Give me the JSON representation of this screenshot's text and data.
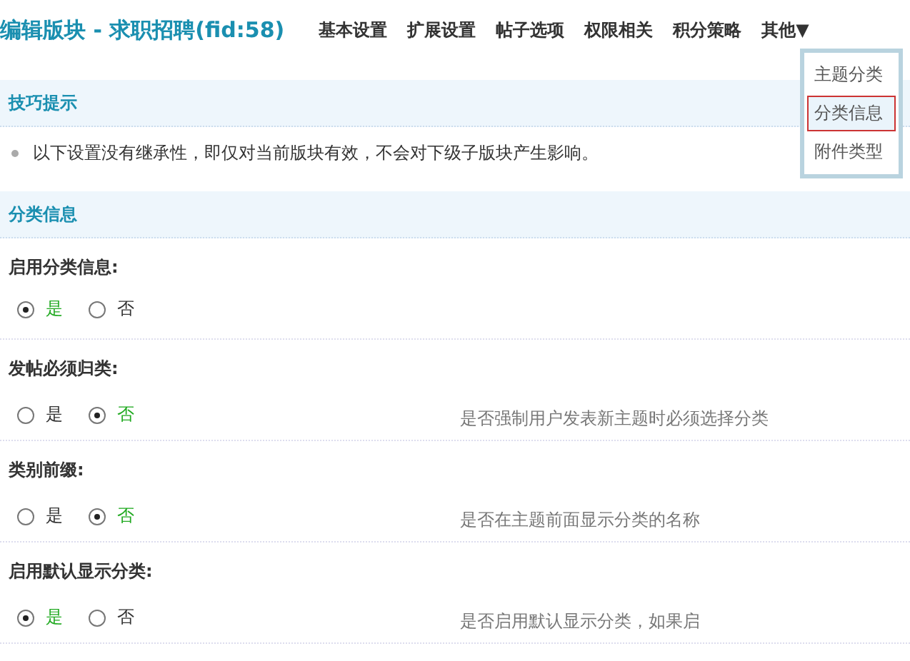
{
  "title": "编辑版块 - 求职招聘(fid:58)",
  "nav": [
    {
      "label": "基本设置",
      "selected": false
    },
    {
      "label": "扩展设置",
      "selected": false
    },
    {
      "label": "帖子选项",
      "selected": false
    },
    {
      "label": "权限相关",
      "selected": false
    },
    {
      "label": "积分策略",
      "selected": false
    },
    {
      "label": "其他",
      "selected": false,
      "caret": "▼"
    }
  ],
  "dropdown": [
    {
      "label": "主题分类",
      "selected": false
    },
    {
      "label": "分类信息",
      "selected": true
    },
    {
      "label": "附件类型",
      "selected": false
    }
  ],
  "tips": {
    "heading": "技巧提示",
    "items": [
      "以下设置没有继承性，即仅对当前版块有效，不会对下级子版块产生影响。"
    ]
  },
  "section": {
    "heading": "分类信息"
  },
  "settings": [
    {
      "label": "启用分类信息:",
      "options": [
        {
          "label": "是",
          "selected": true
        },
        {
          "label": "否",
          "selected": false
        }
      ]
    },
    {
      "label": "发帖必须归类:",
      "options": [
        {
          "label": "是",
          "selected": false
        },
        {
          "label": "否",
          "selected": true
        }
      ],
      "hint": "是否强制用户发表新主题时必须选择分类"
    },
    {
      "label": "类别前缀:",
      "options": [
        {
          "label": "是",
          "selected": false
        },
        {
          "label": "否",
          "selected": true
        }
      ],
      "hint": "是否在主题前面显示分类的名称"
    },
    {
      "label": "启用默认显示分类:",
      "options": [
        {
          "label": "是",
          "selected": true
        },
        {
          "label": "否",
          "selected": false
        }
      ],
      "hint": "是否启用默认显示分类，如果启"
    }
  ]
}
